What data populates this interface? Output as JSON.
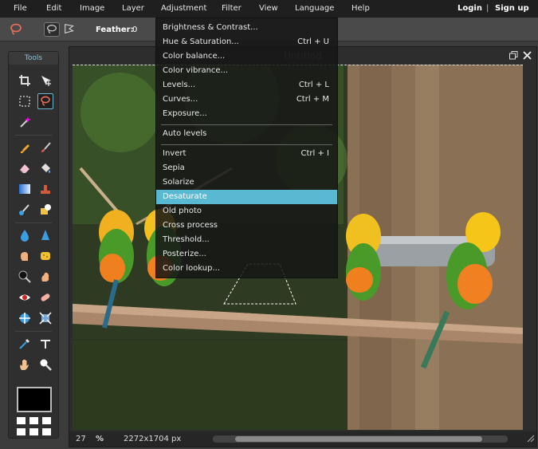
{
  "menubar": {
    "items": [
      "File",
      "Edit",
      "Image",
      "Layer",
      "Adjustment",
      "Filter",
      "View",
      "Language",
      "Help"
    ],
    "login": "Login",
    "separator": "|",
    "signup": "Sign up"
  },
  "optionbar": {
    "tool_icon": "lasso-icon",
    "feather_label": "Feather:",
    "feather_value": "0"
  },
  "tools": {
    "title": "Tools",
    "items": [
      "crop-icon",
      "move-icon",
      "marquee-icon",
      "lasso-icon",
      "magic-wand-icon",
      "pencil-icon",
      "brush-icon",
      "eraser-icon",
      "bucket-icon",
      "gradient-icon",
      "stamp-icon",
      "color-replace-icon",
      "drawing-icon",
      "blur-icon",
      "sharpen-icon",
      "smudge-icon",
      "sponge-icon",
      "dodge-icon",
      "burn-icon",
      "red-eye-icon",
      "spot-heal-icon",
      "bloat-icon",
      "pinch-icon",
      "color-picker-icon",
      "type-icon",
      "hand-icon",
      "zoom-icon"
    ],
    "selected": "lasso-icon",
    "foreground_color": "#000000"
  },
  "document": {
    "title": "Untitled",
    "zoom": "27",
    "zoom_unit": "%",
    "dimensions": "2272x1704 px"
  },
  "adjustment_menu": {
    "items": [
      {
        "label": "Brightness & Contrast...",
        "shortcut": ""
      },
      {
        "label": "Hue & Saturation...",
        "shortcut": "Ctrl + U"
      },
      {
        "label": "Color balance...",
        "shortcut": ""
      },
      {
        "label": "Color vibrance...",
        "shortcut": ""
      },
      {
        "label": "Levels...",
        "shortcut": "Ctrl + L"
      },
      {
        "label": "Curves...",
        "shortcut": "Ctrl + M"
      },
      {
        "label": "Exposure...",
        "shortcut": ""
      },
      {
        "label": "Auto levels",
        "shortcut": ""
      },
      {
        "label": "Invert",
        "shortcut": "Ctrl + I"
      },
      {
        "label": "Sepia",
        "shortcut": ""
      },
      {
        "label": "Solarize",
        "shortcut": ""
      },
      {
        "label": "Desaturate",
        "shortcut": ""
      },
      {
        "label": "Old photo",
        "shortcut": ""
      },
      {
        "label": "Cross process",
        "shortcut": ""
      },
      {
        "label": "Threshold...",
        "shortcut": ""
      },
      {
        "label": "Posterize...",
        "shortcut": ""
      },
      {
        "label": "Color lookup...",
        "shortcut": ""
      }
    ],
    "highlighted": "Desaturate",
    "highlight_color": "#59b9d2"
  }
}
